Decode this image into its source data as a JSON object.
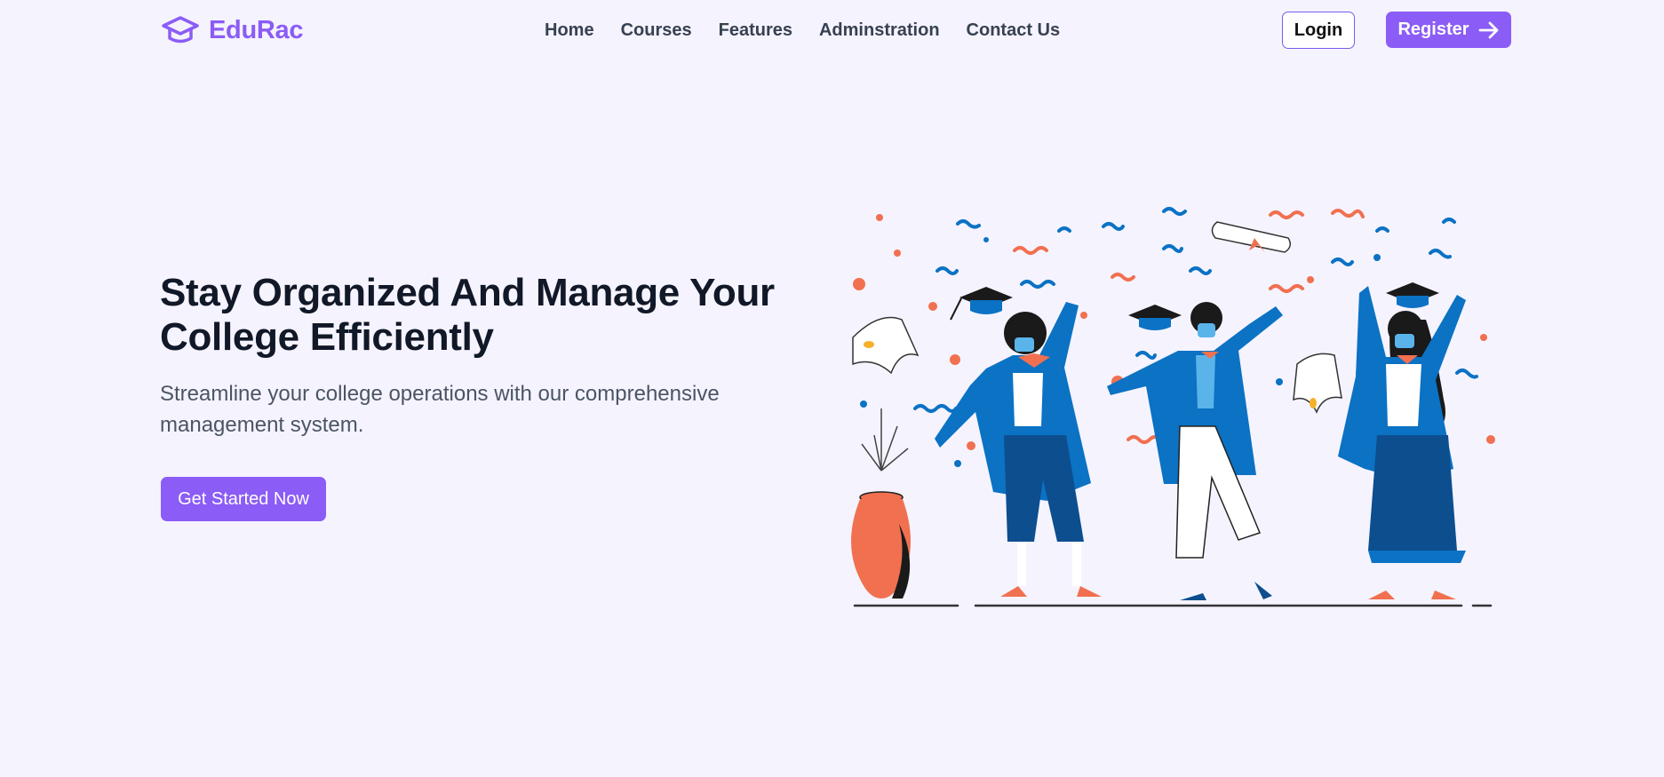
{
  "header": {
    "brand": "EduRac",
    "logo_icon": "graduation-cap-icon",
    "nav": [
      "Home",
      "Courses",
      "Features",
      "Adminstration",
      "Contact Us"
    ],
    "login_label": "Login",
    "register_label": "Register",
    "register_icon": "arrow-right-icon"
  },
  "hero": {
    "title": "Stay Organized And Manage Your College Efficiently",
    "subtitle": "Streamline your college operations with our comprehensive management system.",
    "cta_label": "Get Started Now"
  },
  "colors": {
    "accent": "#8b5cf6",
    "background": "#f5f3fe",
    "gown_blue": "#0b72c4",
    "dark_blue": "#0d4e8f",
    "coral": "#f07050"
  }
}
